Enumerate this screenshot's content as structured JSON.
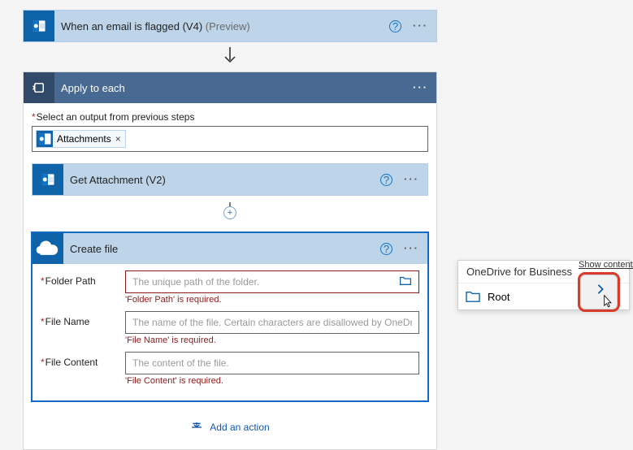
{
  "trigger": {
    "title": "When an email is flagged (V4)",
    "preview": "(Preview)"
  },
  "scope": {
    "title": "Apply to each",
    "output_label": "Select an output from previous steps",
    "token": "Attachments"
  },
  "get_attachment": {
    "title": "Get Attachment (V2)"
  },
  "create_file": {
    "title": "Create file",
    "fields": {
      "folder": {
        "label": "Folder Path",
        "placeholder": "The unique path of the folder.",
        "error": "'Folder Path' is required."
      },
      "filename": {
        "label": "File Name",
        "placeholder": "The name of the file. Certain characters are disallowed by OneDrive and will be",
        "error": "'File Name' is required."
      },
      "content": {
        "label": "File Content",
        "placeholder": "The content of the file.",
        "error": "'File Content' is required."
      }
    }
  },
  "add_action": "Add an action",
  "picker": {
    "header": "OneDrive for Business",
    "root": "Root",
    "tooltip": "Show contents"
  }
}
